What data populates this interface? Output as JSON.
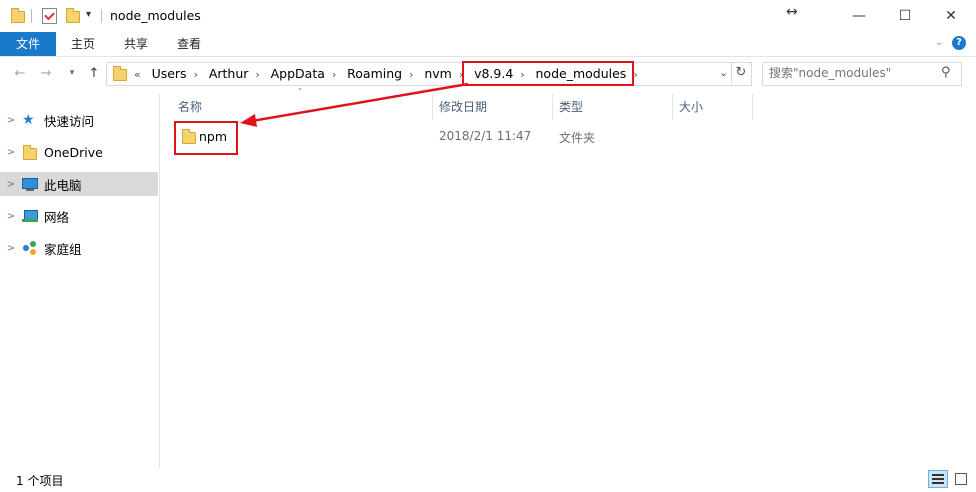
{
  "window": {
    "title": "node_modules",
    "controls": {
      "resize": "↔",
      "minimize": "—",
      "maximize": "☐",
      "close": "✕"
    }
  },
  "ribbon": {
    "tabs": [
      "文件",
      "主页",
      "共享",
      "查看"
    ]
  },
  "address": {
    "overflow": "«",
    "crumbs": [
      "Users",
      "Arthur",
      "AppData",
      "Roaming",
      "nvm",
      "v8.9.4",
      "node_modules"
    ]
  },
  "search": {
    "placeholder": "搜索\"node_modules\""
  },
  "sidebar": {
    "items": [
      {
        "label": "快速访问",
        "icon": "star-icon"
      },
      {
        "label": "OneDrive",
        "icon": "folder-icon"
      },
      {
        "label": "此电脑",
        "icon": "computer-icon",
        "selected": true
      },
      {
        "label": "网络",
        "icon": "network-icon"
      },
      {
        "label": "家庭组",
        "icon": "homegroup-icon"
      }
    ]
  },
  "columns": [
    "名称",
    "修改日期",
    "类型",
    "大小"
  ],
  "rows": [
    {
      "name": "npm",
      "modified": "2018/2/1 11:47",
      "type": "文件夹",
      "size": ""
    }
  ],
  "status": {
    "count_text": "1 个项目"
  },
  "colors": {
    "accent": "#1979ca",
    "highlight": "#e0131b",
    "folder": "#f7d36b"
  }
}
